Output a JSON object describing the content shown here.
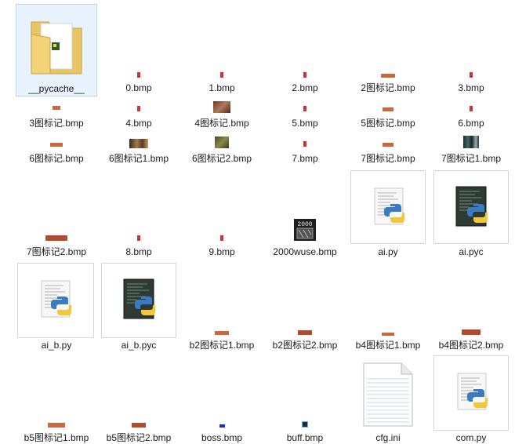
{
  "files": [
    {
      "name": "__pycache__",
      "icon": "folder-icon"
    },
    {
      "name": "0.bmp",
      "icon": "bmp-digit-icon"
    },
    {
      "name": "1.bmp",
      "icon": "bmp-digit-icon"
    },
    {
      "name": "2.bmp",
      "icon": "bmp-digit-icon"
    },
    {
      "name": "2图标记.bmp",
      "icon": "bmp-bar-icon"
    },
    {
      "name": "3.bmp",
      "icon": "bmp-digit-icon"
    },
    {
      "name": "3图标记.bmp",
      "icon": "bmp-bar-icon"
    },
    {
      "name": "4.bmp",
      "icon": "bmp-digit-icon"
    },
    {
      "name": "4图标记.bmp",
      "icon": "bmp-photo-icon"
    },
    {
      "name": "5.bmp",
      "icon": "bmp-digit-icon"
    },
    {
      "name": "5图标记.bmp",
      "icon": "bmp-bar-icon"
    },
    {
      "name": "6.bmp",
      "icon": "bmp-digit-icon"
    },
    {
      "name": "6图标记.bmp",
      "icon": "bmp-bar-icon"
    },
    {
      "name": "6图标记1.bmp",
      "icon": "bmp-photo-icon"
    },
    {
      "name": "6图标记2.bmp",
      "icon": "bmp-photo-icon"
    },
    {
      "name": "7.bmp",
      "icon": "bmp-digit-icon"
    },
    {
      "name": "7图标记.bmp",
      "icon": "bmp-bar-icon"
    },
    {
      "name": "7图标记1.bmp",
      "icon": "bmp-photo-icon"
    },
    {
      "name": "7图标记2.bmp",
      "icon": "bmp-bar-icon"
    },
    {
      "name": "8.bmp",
      "icon": "bmp-digit-icon"
    },
    {
      "name": "9.bmp",
      "icon": "bmp-digit-icon"
    },
    {
      "name": "2000wuse.bmp",
      "icon": "bmp-photo-icon"
    },
    {
      "name": "ai.py",
      "icon": "python-script-icon"
    },
    {
      "name": "ai.pyc",
      "icon": "python-compiled-icon"
    },
    {
      "name": "ai_b.py",
      "icon": "python-script-icon"
    },
    {
      "name": "ai_b.pyc",
      "icon": "python-compiled-icon"
    },
    {
      "name": "b2图标记1.bmp",
      "icon": "bmp-bar-icon"
    },
    {
      "name": "b2图标记2.bmp",
      "icon": "bmp-bar-icon"
    },
    {
      "name": "b4图标记1.bmp",
      "icon": "bmp-bar-icon"
    },
    {
      "name": "b4图标记2.bmp",
      "icon": "bmp-bar-icon"
    },
    {
      "name": "b5图标记1.bmp",
      "icon": "bmp-bar-icon"
    },
    {
      "name": "b5图标记2.bmp",
      "icon": "bmp-bar-icon"
    },
    {
      "name": "boss.bmp",
      "icon": "bmp-small-icon"
    },
    {
      "name": "buff.bmp",
      "icon": "bmp-small-icon"
    },
    {
      "name": "cfg.ini",
      "icon": "text-file-icon"
    },
    {
      "name": "com.py",
      "icon": "python-script-icon"
    }
  ]
}
